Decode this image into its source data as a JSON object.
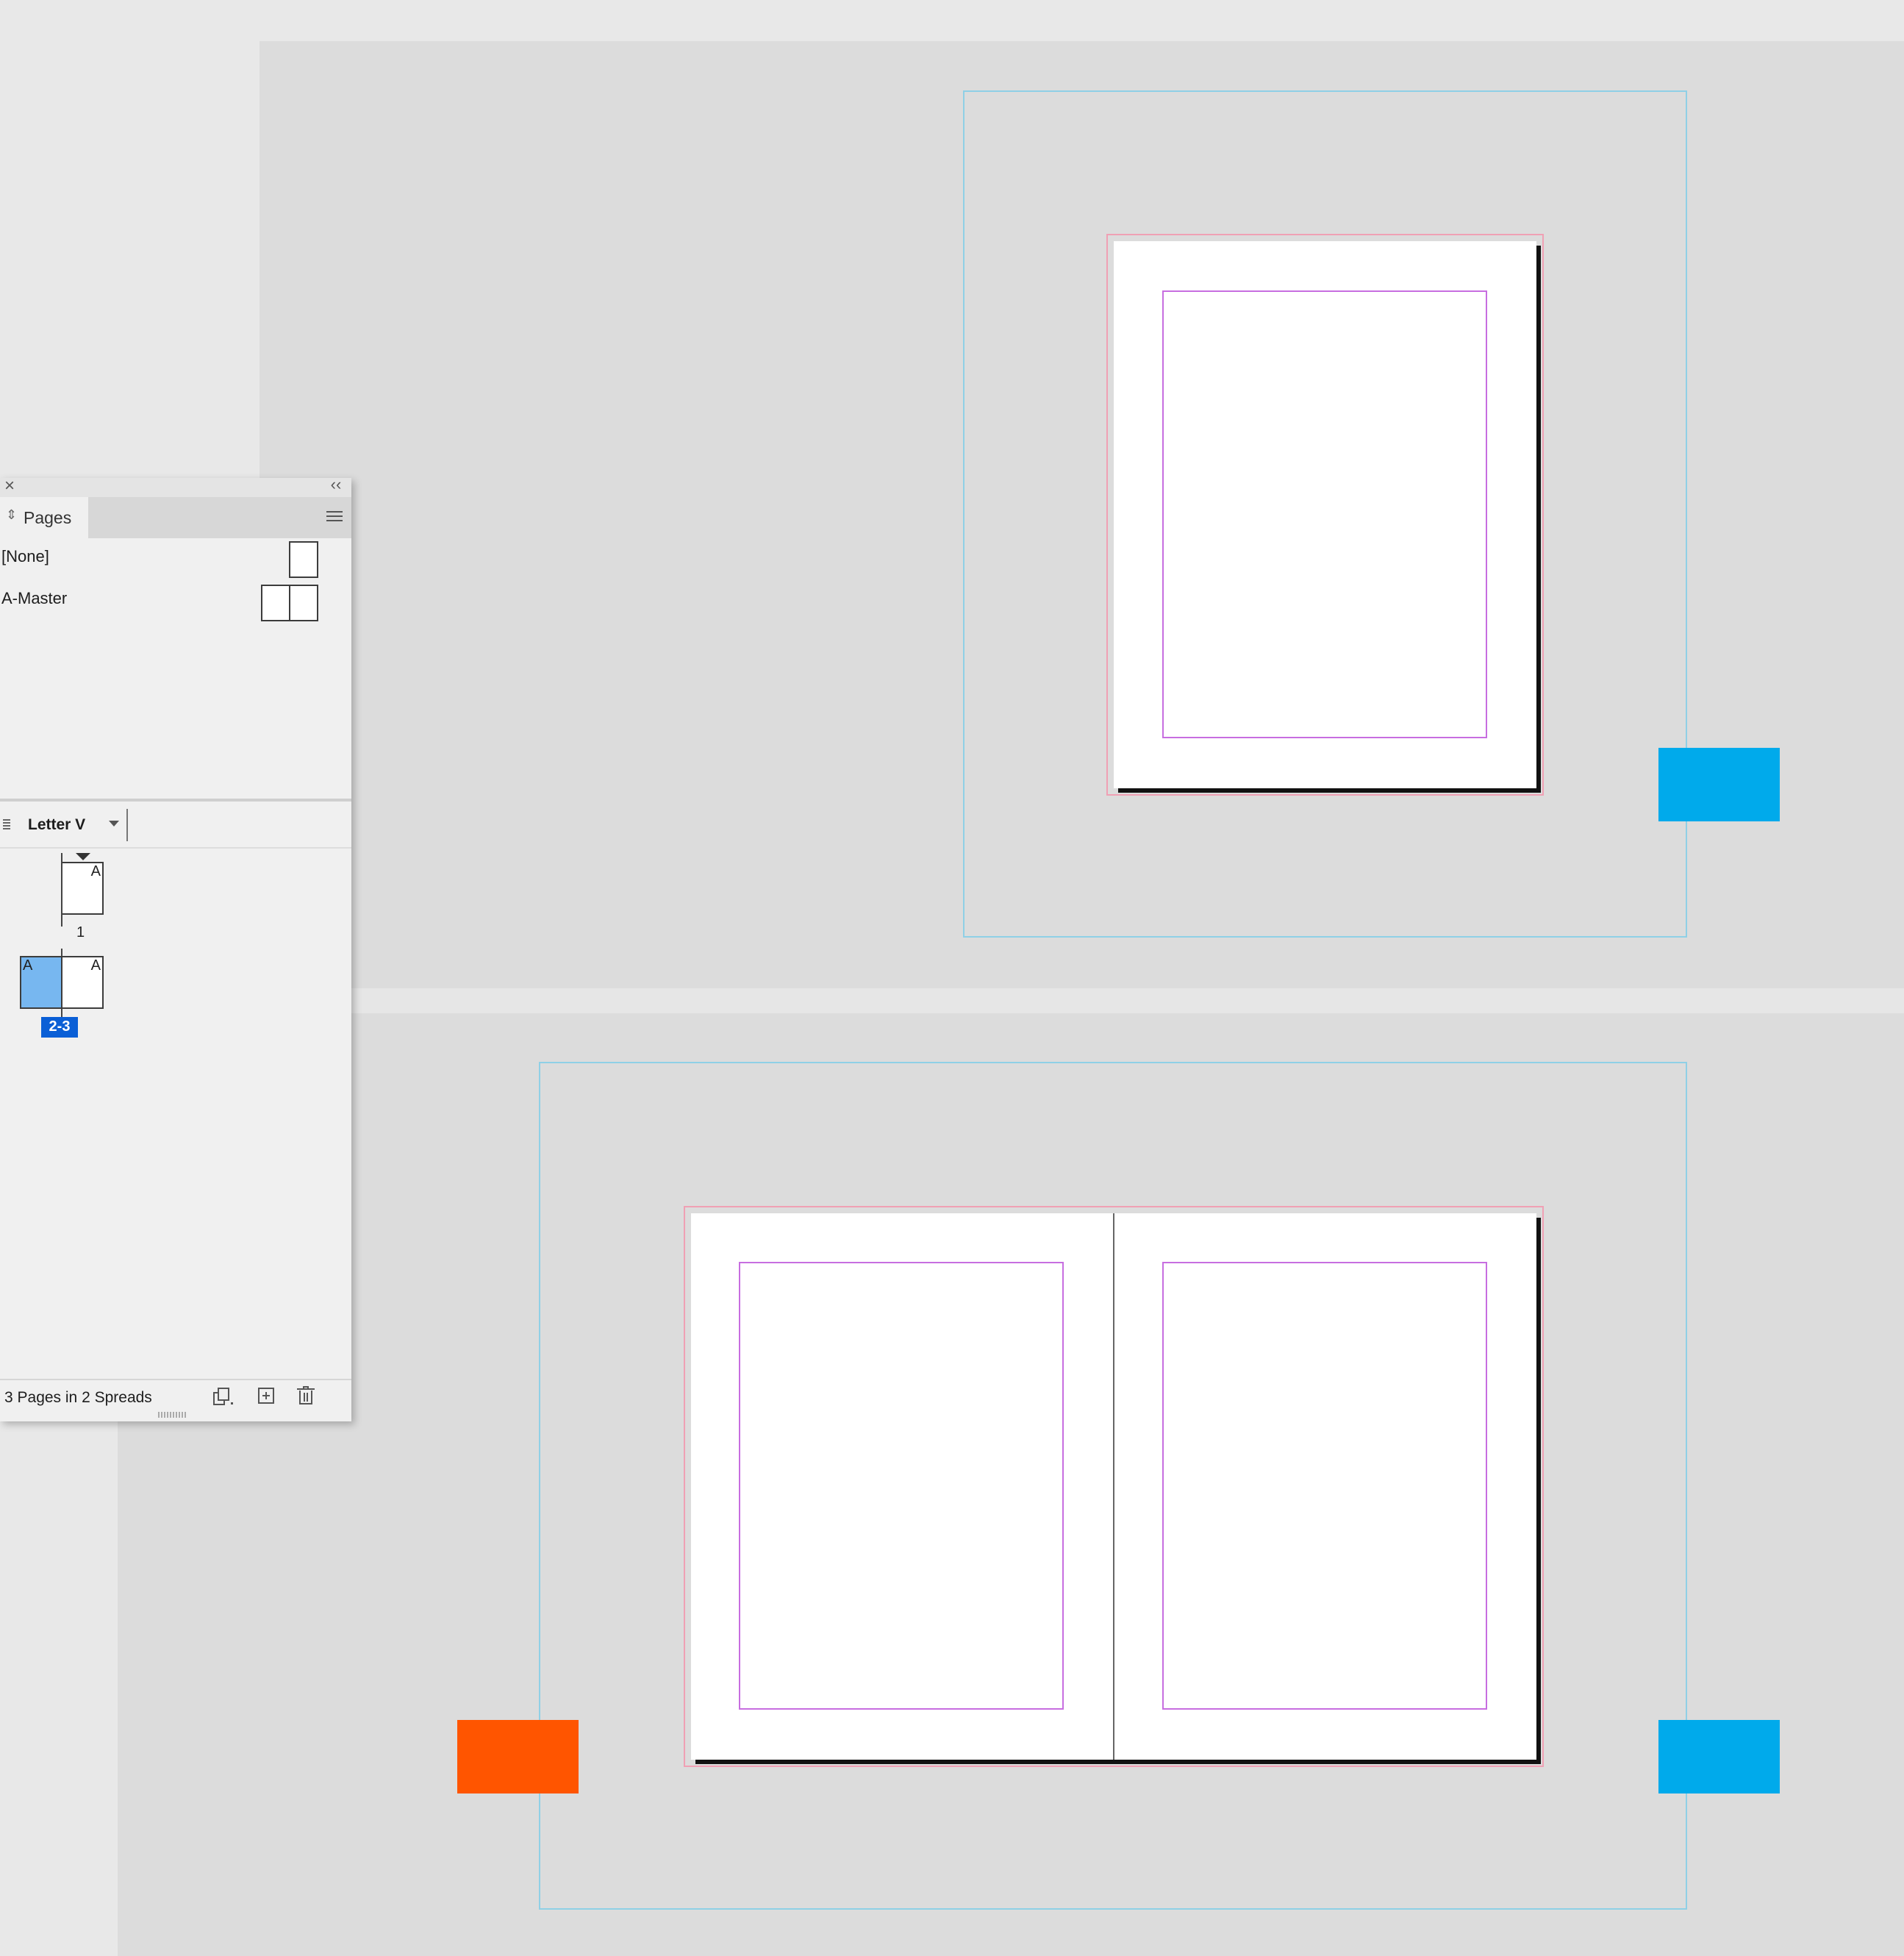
{
  "colors": {
    "pasteboard": "#dcdcdc",
    "slug_guide": "#8fd0e6",
    "bleed_guide": "#f0a0b4",
    "margin_guide": "#c76ee0",
    "tab_blue": "#00aaeb",
    "tab_orange": "#ff5500",
    "selection": "#0a5fd6"
  },
  "panel": {
    "close_icon": "close-icon",
    "collapse_icon": "double-chevron-left-icon",
    "tab_label": "Pages",
    "menu_icon": "hamburger-menu-icon",
    "masters": [
      {
        "label": "[None]"
      },
      {
        "label": "A-Master"
      }
    ],
    "page_size": "Letter V",
    "pages": [
      {
        "number_label": "1",
        "master_prefix": "A"
      },
      {
        "number_label": "2-3",
        "left_prefix": "A",
        "right_prefix": "A"
      }
    ],
    "footer": {
      "status": "3 Pages in 2 Spreads",
      "buttons": [
        "edit-page-size-icon",
        "new-page-icon",
        "delete-page-icon"
      ]
    }
  }
}
